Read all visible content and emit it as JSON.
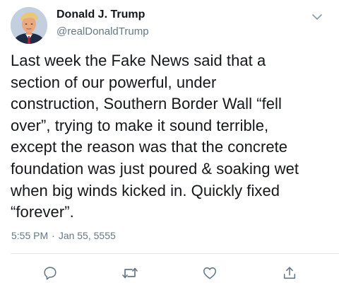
{
  "user": {
    "display_name": "Donald J. Trump",
    "handle": "@realDonaldTrump",
    "avatar_icon": "profile-photo"
  },
  "tweet": {
    "text": "Last week the Fake News said that a\nsection of our powerful, under\nconstruction, Southern Border Wall “fell\nover”, trying to make it sound terrible,\nexcept the reason was that the concrete\nfoundation was just poured & soaking wet\nwhen big winds kicked in. Quickly fixed\n“forever”.",
    "time": "5:55 PM",
    "separator": "·",
    "date": "Jan 55, 5555"
  },
  "actions": [
    {
      "name": "reply",
      "icon": "speech-bubble-icon"
    },
    {
      "name": "retweet",
      "icon": "retweet-arrows-icon"
    },
    {
      "name": "like",
      "icon": "heart-icon"
    },
    {
      "name": "share",
      "icon": "share-icon"
    }
  ],
  "colors": {
    "text_primary": "#14171a",
    "text_secondary": "#657786",
    "divider": "#e1e8ed",
    "icon": "#657786"
  }
}
